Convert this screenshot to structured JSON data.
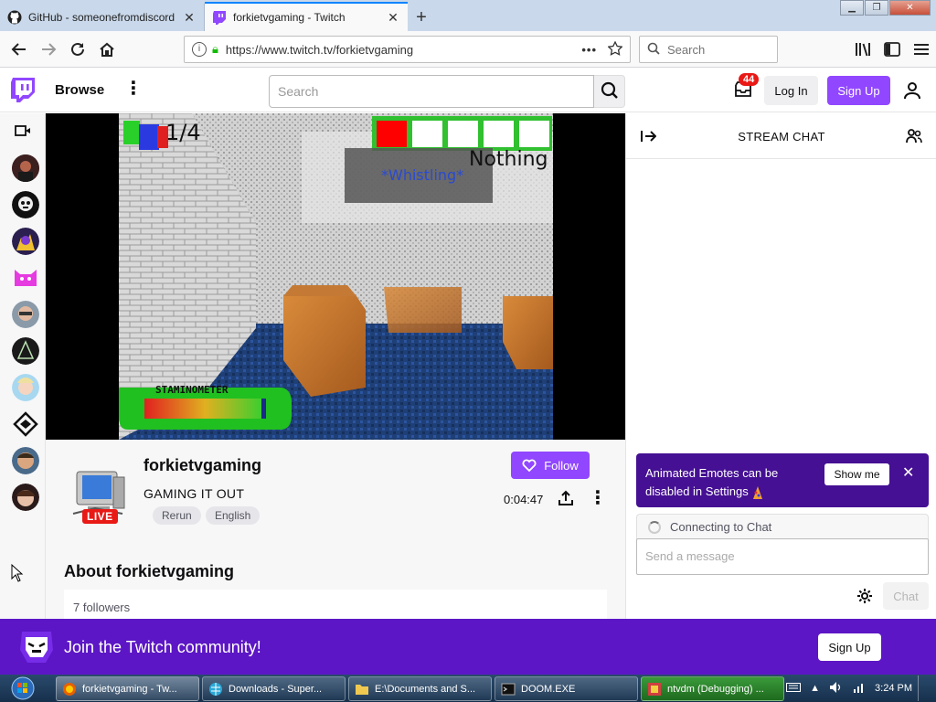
{
  "browser": {
    "tabs": [
      {
        "title": "GitHub - someonefromdiscord",
        "active": false
      },
      {
        "title": "forkietvgaming - Twitch",
        "active": true
      }
    ],
    "url": "https://www.twitch.tv/forkietvgaming",
    "search_placeholder": "Search"
  },
  "twitch": {
    "browse": "Browse",
    "search_placeholder": "Search",
    "inbox_count": "44",
    "login": "Log In",
    "signup": "Sign Up"
  },
  "game_hud": {
    "notebooks": "1/4",
    "item_label": "Nothing",
    "subtitle": "*Whistling*",
    "stamina_label": "STAMINOMETER"
  },
  "channel": {
    "name": "forkietvgaming",
    "title": "GAMING IT OUT",
    "live": "LIVE",
    "tags": [
      "Rerun",
      "English"
    ],
    "follow": "Follow",
    "uptime": "0:04:47",
    "about_title": "About forkietvgaming",
    "followers": "7 followers"
  },
  "chat": {
    "header": "STREAM CHAT",
    "notice": "Animated Emotes can be disabled in Settings",
    "show_me": "Show me",
    "connecting": "Connecting to Chat",
    "send_placeholder": "Send a message",
    "chat_button": "Chat"
  },
  "banner": {
    "text": "Join the Twitch community!",
    "signup": "Sign Up"
  },
  "taskbar": {
    "items": [
      {
        "label": "forkietvgaming - Tw..."
      },
      {
        "label": "Downloads - Super..."
      },
      {
        "label": "E:\\Documents and S..."
      },
      {
        "label": "DOOM.EXE"
      },
      {
        "label": "ntvdm (Debugging) ..."
      }
    ],
    "clock": "3:24 PM"
  },
  "colors": {
    "twitch_purple": "#9147ff",
    "banner_purple": "#5c16c5",
    "live_red": "#e91916"
  }
}
